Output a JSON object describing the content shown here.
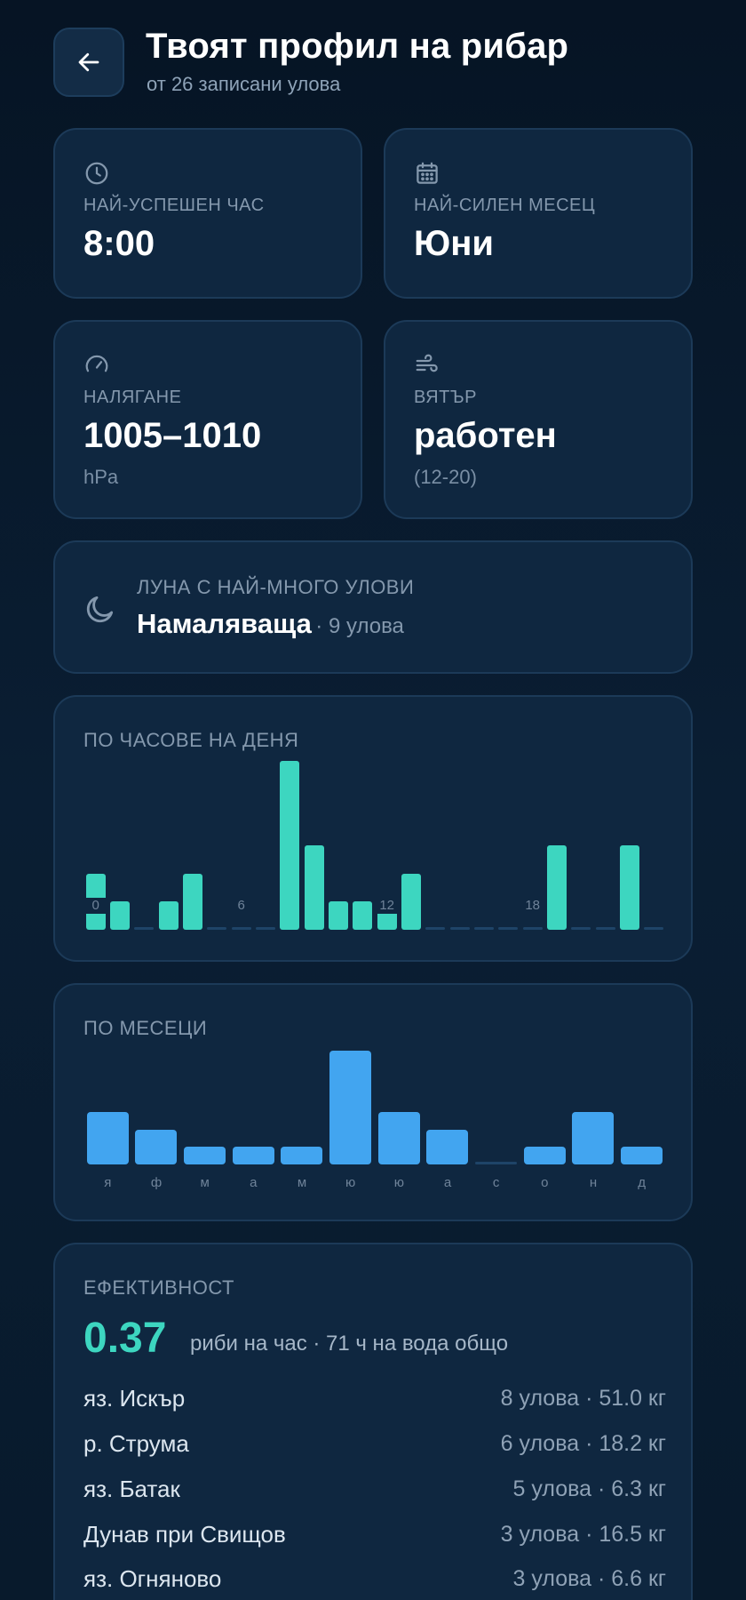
{
  "header": {
    "title": "Твоят профил на рибар",
    "subtitle": "от 26 записани улова"
  },
  "stats": {
    "best_hour": {
      "label": "НАЙ-УСПЕШЕН ЧАС",
      "value": "8:00",
      "icon": "clock-icon"
    },
    "best_month": {
      "label": "НАЙ-СИЛЕН МЕСЕЦ",
      "value": "Юни",
      "icon": "calendar-icon"
    },
    "pressure": {
      "label": "НАЛЯГАНЕ",
      "value": "1005–1010",
      "unit": "hPa",
      "icon": "gauge-icon"
    },
    "wind": {
      "label": "ВЯТЪР",
      "value": "работен",
      "range": "(12-20)",
      "icon": "wind-icon"
    }
  },
  "moon": {
    "label": "ЛУНА С НАЙ-МНОГО УЛОВИ",
    "value": "Намаляваща",
    "count": "· 9 улова",
    "icon": "moon-icon"
  },
  "hourly": {
    "label": "ПО ЧАСОВЕ НА ДЕНЯ",
    "tick_labels": [
      "0",
      "6",
      "12",
      "18"
    ],
    "chart_data": {
      "type": "bar",
      "categories": [
        "0",
        "1",
        "2",
        "3",
        "4",
        "5",
        "6",
        "7",
        "8",
        "9",
        "10",
        "11",
        "12",
        "13",
        "14",
        "15",
        "16",
        "17",
        "18",
        "19",
        "20",
        "21",
        "22",
        "23"
      ],
      "values": [
        2,
        1,
        0,
        1,
        2,
        0,
        0,
        0,
        6,
        3,
        1,
        1,
        1,
        2,
        0,
        0,
        0,
        0,
        0,
        3,
        0,
        0,
        3,
        0
      ],
      "ylim": [
        0,
        6
      ]
    },
    "colors": {
      "bar": "#3dd6c0",
      "empty": "#1e4468"
    }
  },
  "monthly": {
    "label": "ПО МЕСЕЦИ",
    "chart_data": {
      "type": "bar",
      "categories": [
        "я",
        "ф",
        "м",
        "а",
        "м",
        "ю",
        "ю",
        "а",
        "с",
        "о",
        "н",
        "д"
      ],
      "values": [
        3,
        2,
        1,
        1,
        1,
        6.5,
        3,
        2,
        0,
        1,
        3,
        1
      ],
      "ylim": [
        0,
        6.5
      ]
    },
    "colors": {
      "bar": "#42a5f0",
      "empty": "#1e4468"
    }
  },
  "efficiency": {
    "label": "ЕФЕКТИВНОСТ",
    "value": "0.37",
    "text": "риби на час · 71 ч на вода общо",
    "spots": [
      {
        "name": "яз. Искър",
        "stat": "8 улова · 51.0 кг"
      },
      {
        "name": "р. Струма",
        "stat": "6 улова · 18.2 кг"
      },
      {
        "name": "яз. Батак",
        "stat": "5 улова · 6.3 кг"
      },
      {
        "name": "Дунав при Свищов",
        "stat": "3 улова · 16.5 кг"
      },
      {
        "name": "яз. Огняново",
        "stat": "3 улова · 6.6 кг"
      }
    ]
  },
  "colors": {
    "accent_teal": "#3dd6c0",
    "accent_blue": "#42a5f0",
    "card_bg": "#0f2740",
    "page_bg": "#061424"
  }
}
